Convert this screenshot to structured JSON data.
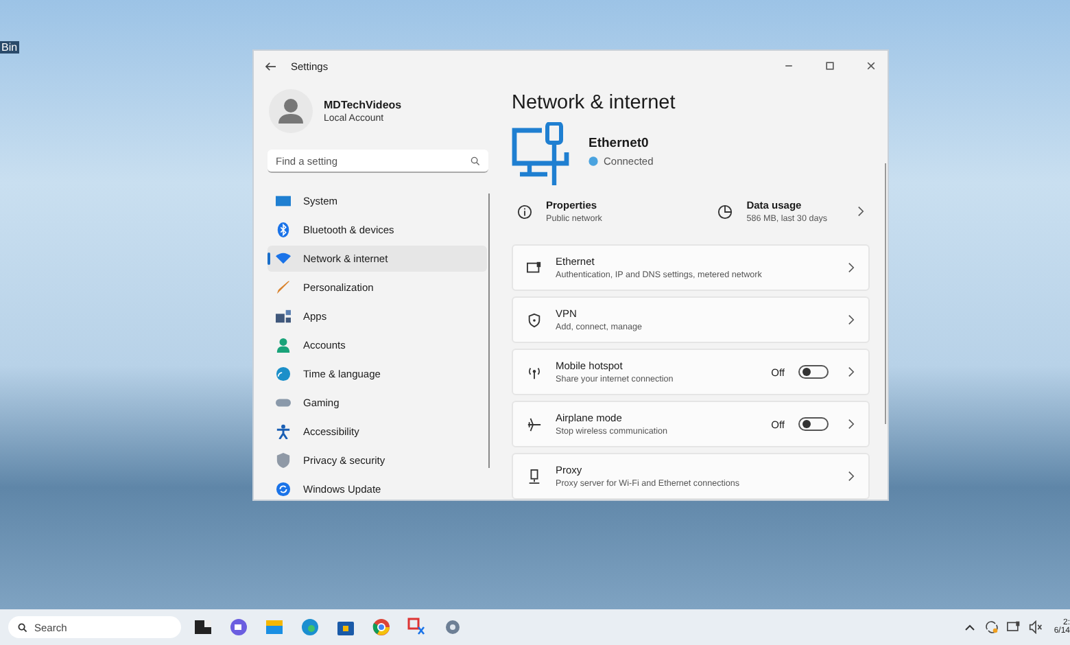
{
  "desktop": {
    "icon_label": "Bin"
  },
  "window": {
    "title": "Settings"
  },
  "account": {
    "name": "MDTechVideos",
    "type": "Local Account"
  },
  "search": {
    "placeholder": "Find a setting"
  },
  "nav": [
    {
      "label": "System",
      "selected": false
    },
    {
      "label": "Bluetooth & devices",
      "selected": false
    },
    {
      "label": "Network & internet",
      "selected": true
    },
    {
      "label": "Personalization",
      "selected": false
    },
    {
      "label": "Apps",
      "selected": false
    },
    {
      "label": "Accounts",
      "selected": false
    },
    {
      "label": "Time & language",
      "selected": false
    },
    {
      "label": "Gaming",
      "selected": false
    },
    {
      "label": "Accessibility",
      "selected": false
    },
    {
      "label": "Privacy & security",
      "selected": false
    },
    {
      "label": "Windows Update",
      "selected": false
    }
  ],
  "page": {
    "title": "Network & internet",
    "adapter": "Ethernet0",
    "status": "Connected",
    "properties": {
      "title": "Properties",
      "subtitle": "Public network"
    },
    "data_usage": {
      "title": "Data usage",
      "subtitle": "586 MB, last 30 days"
    }
  },
  "cards": [
    {
      "kind": "link",
      "title": "Ethernet",
      "subtitle": "Authentication, IP and DNS settings, metered network"
    },
    {
      "kind": "link",
      "title": "VPN",
      "subtitle": "Add, connect, manage"
    },
    {
      "kind": "toggle",
      "title": "Mobile hotspot",
      "subtitle": "Share your internet connection",
      "state_label": "Off",
      "on": false
    },
    {
      "kind": "toggle",
      "title": "Airplane mode",
      "subtitle": "Stop wireless communication",
      "state_label": "Off",
      "on": false
    },
    {
      "kind": "link",
      "title": "Proxy",
      "subtitle": "Proxy server for Wi-Fi and Ethernet connections"
    }
  ],
  "taskbar": {
    "search_placeholder": "Search",
    "clock_time": "2:",
    "clock_date": "6/14"
  }
}
